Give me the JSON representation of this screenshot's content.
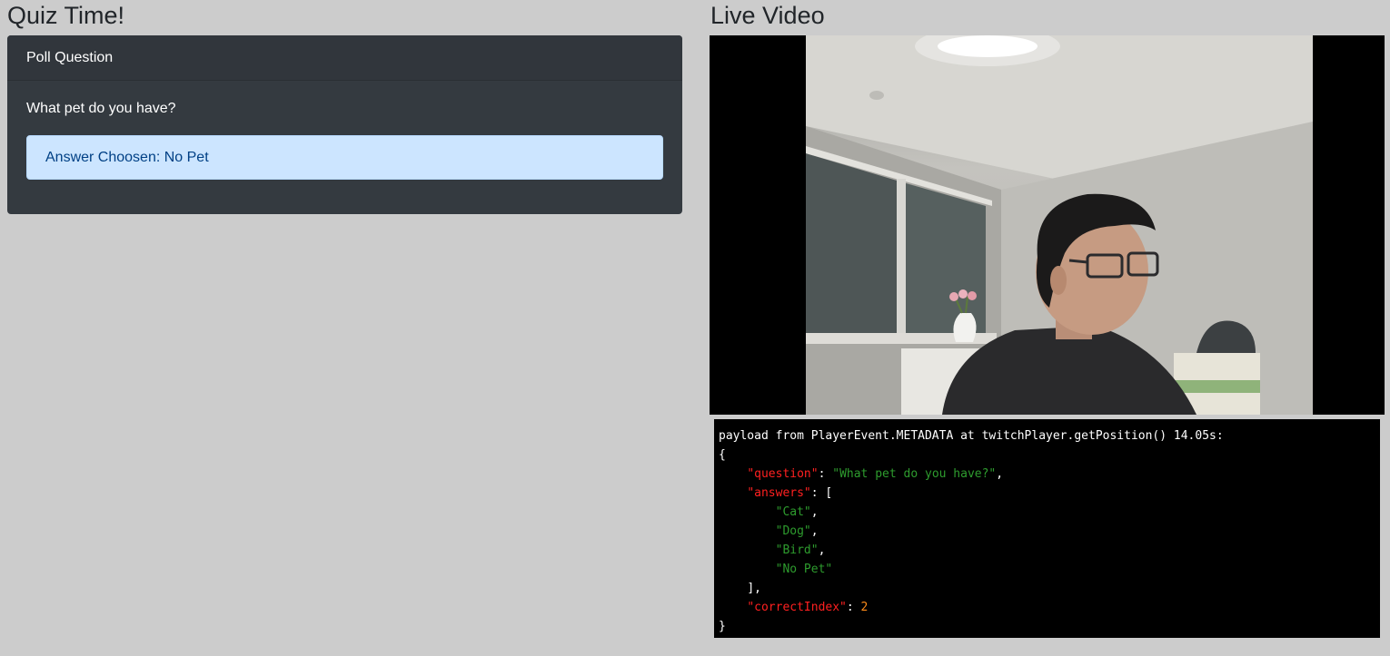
{
  "quiz": {
    "heading": "Quiz Time!",
    "card_header": "Poll Question",
    "question": "What pet do you have?",
    "answer_alert": "Answer Choosen: No Pet"
  },
  "video": {
    "heading": "Live Video"
  },
  "metadata": {
    "intro": "payload from PlayerEvent.METADATA at twitchPlayer.getPosition() 14.05s:",
    "open_brace": "{",
    "question_key": "\"question\"",
    "question_value": "\"What pet do you have?\"",
    "answers_key": "\"answers\"",
    "open_bracket": "[",
    "answers": [
      "\"Cat\"",
      "\"Dog\"",
      "\"Bird\"",
      "\"No Pet\""
    ],
    "close_bracket": "],",
    "correct_key": "\"correctIndex\"",
    "correct_value": "2",
    "close_brace": "}"
  },
  "colors": {
    "card_bg": "#343a40",
    "alert_bg": "#cce5ff",
    "alert_text": "#004085",
    "json_key": "#ff2020",
    "json_string": "#2e9c2e",
    "json_number": "#ff8c1a"
  }
}
